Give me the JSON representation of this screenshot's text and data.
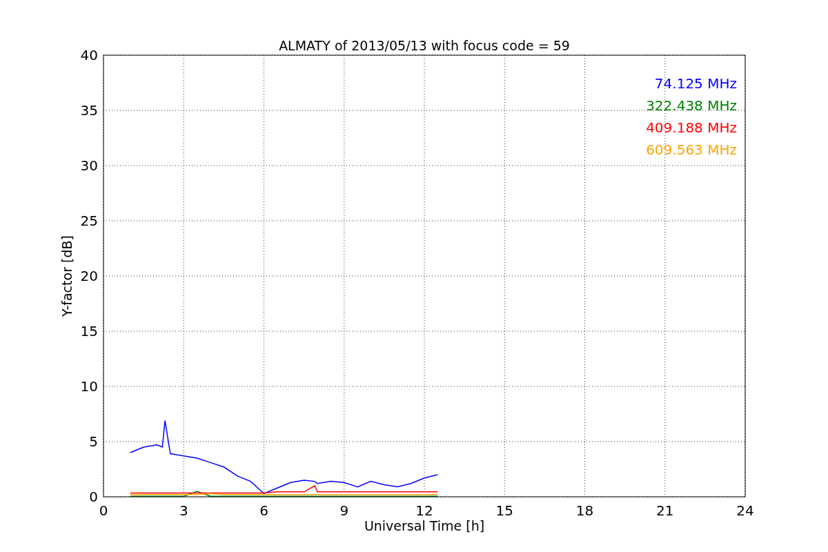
{
  "chart_data": {
    "type": "line",
    "title": "ALMATY of 2013/05/13 with focus code = 59",
    "xlabel": "Universal Time [h]",
    "ylabel": "Y-factor [dB]",
    "x": [
      1,
      1.5,
      2,
      2.2,
      2.3,
      2.5,
      3,
      3.5,
      4,
      4.5,
      5,
      5.5,
      6,
      6.5,
      7,
      7.5,
      7.9,
      8,
      8.5,
      9,
      9.5,
      10,
      10.5,
      11,
      11.5,
      12,
      12.5
    ],
    "series": [
      {
        "name": "74.125 MHz",
        "color": "#0000ff",
        "values": [
          4.0,
          4.5,
          4.7,
          4.5,
          6.9,
          3.9,
          3.7,
          3.5,
          3.1,
          2.7,
          1.9,
          1.4,
          0.3,
          0.8,
          1.3,
          1.5,
          1.4,
          1.2,
          1.4,
          1.3,
          0.9,
          1.4,
          1.1,
          0.9,
          1.2,
          1.7,
          2.0
        ]
      },
      {
        "name": "322.438 MHz",
        "color": "#008000",
        "values": [
          0.05,
          0.05,
          0.05,
          0.05,
          0.05,
          0.05,
          0.05,
          0.5,
          0.05,
          0.05,
          0.05,
          0.05,
          0.05,
          0.05,
          0.05,
          0.05,
          0.05,
          0.05,
          0.05,
          0.05,
          0.05,
          0.05,
          0.05,
          0.05,
          0.05,
          0.05,
          0.05
        ]
      },
      {
        "name": "409.188 MHz",
        "color": "#ff0000",
        "values": [
          0.35,
          0.35,
          0.35,
          0.35,
          0.35,
          0.35,
          0.35,
          0.35,
          0.35,
          0.35,
          0.35,
          0.35,
          0.35,
          0.45,
          0.45,
          0.45,
          1.0,
          0.45,
          0.45,
          0.45,
          0.45,
          0.45,
          0.45,
          0.45,
          0.45,
          0.45,
          0.45
        ]
      },
      {
        "name": "609.563 MHz",
        "color": "#ffa500",
        "values": [
          0.2,
          0.2,
          0.2,
          0.2,
          0.2,
          0.2,
          0.2,
          0.2,
          0.3,
          0.2,
          0.2,
          0.2,
          0.2,
          0.2,
          0.2,
          0.2,
          0.2,
          0.2,
          0.2,
          0.2,
          0.2,
          0.2,
          0.2,
          0.2,
          0.2,
          0.2,
          0.2
        ]
      }
    ],
    "grid": true,
    "xlim": [
      0,
      24
    ],
    "ylim": [
      0,
      40
    ],
    "xticks": [
      0,
      3,
      6,
      9,
      12,
      15,
      18,
      21,
      24
    ],
    "yticks": [
      0,
      5,
      10,
      15,
      20,
      25,
      30,
      35,
      40
    ]
  }
}
